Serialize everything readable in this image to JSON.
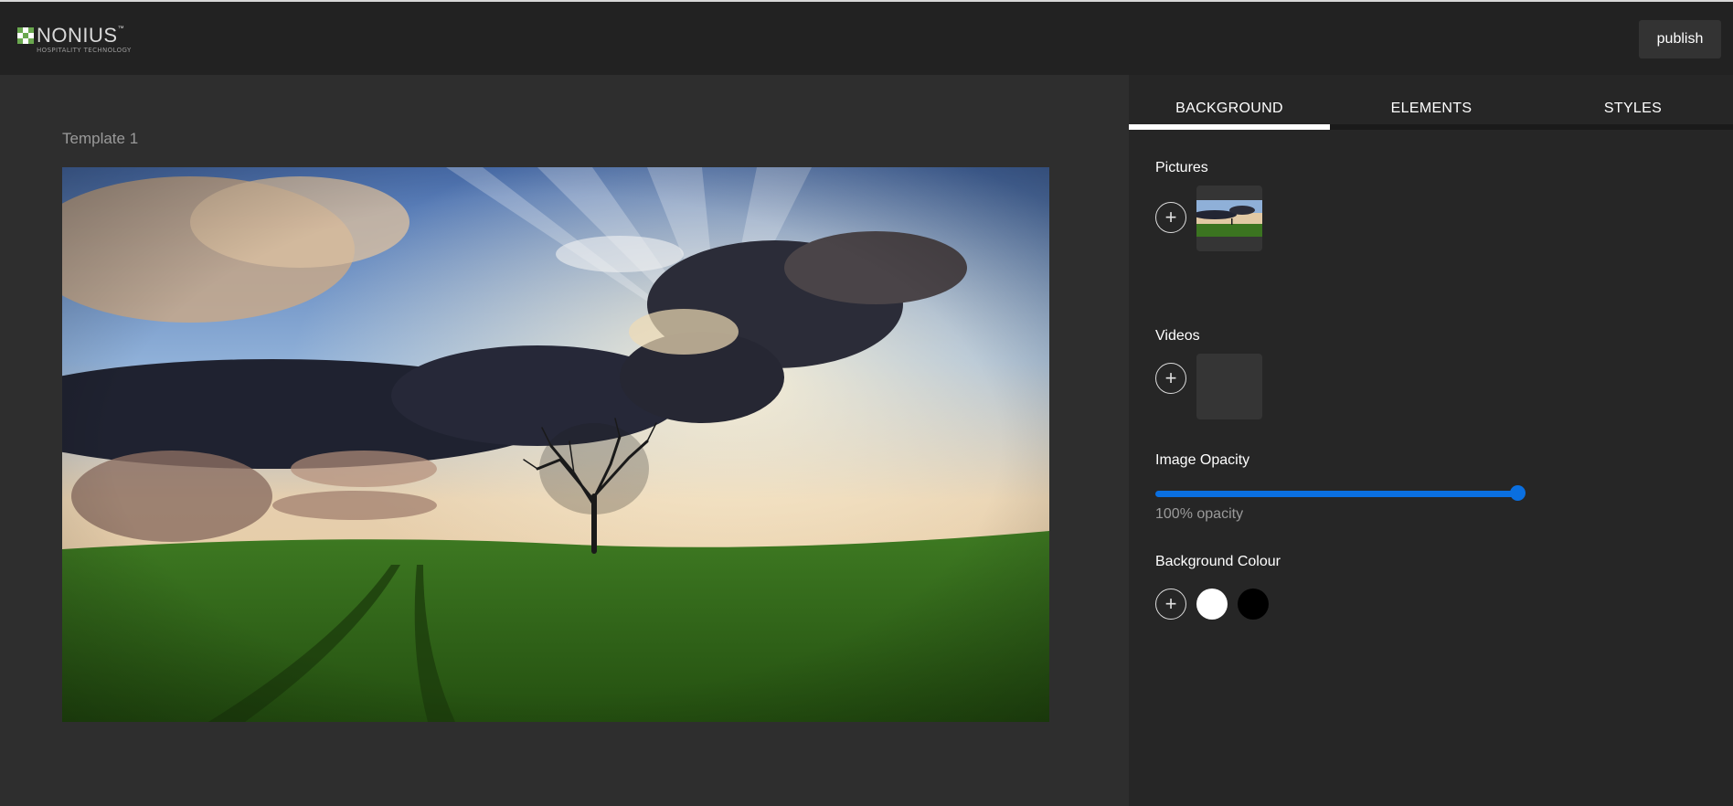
{
  "header": {
    "logo_name": "NONIUS",
    "logo_tm": "™",
    "logo_sub": "HOSPITALITY TECHNOLOGY",
    "publish_label": "publish"
  },
  "canvas": {
    "template_title": "Template 1"
  },
  "panel": {
    "tabs": [
      {
        "label": "BACKGROUND",
        "active": true
      },
      {
        "label": "ELEMENTS",
        "active": false
      },
      {
        "label": "STYLES",
        "active": false
      }
    ],
    "pictures_label": "Pictures",
    "videos_label": "Videos",
    "opacity_label": "Image Opacity",
    "opacity_value": 100,
    "opacity_text": "100% opacity",
    "bg_colour_label": "Background Colour",
    "swatches": [
      "#ffffff",
      "#000000"
    ],
    "add_icon": "plus-icon"
  },
  "colors": {
    "accent": "#0a6fe0",
    "header_bg": "#222222",
    "panel_bg": "#262626",
    "canvas_bg": "#2e2e2e"
  }
}
